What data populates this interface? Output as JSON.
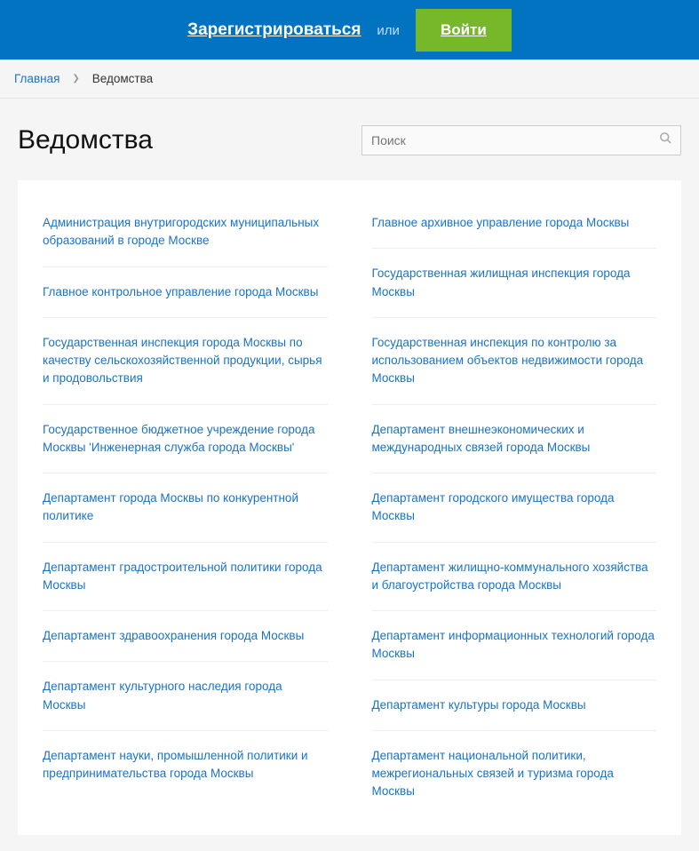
{
  "header": {
    "register": "Зарегистрироваться",
    "or": "или",
    "login": "Войти"
  },
  "breadcrumb": {
    "home": "Главная",
    "current": "Ведомства"
  },
  "page_title": "Ведомства",
  "search": {
    "placeholder": "Поиск"
  },
  "departments": {
    "left": [
      "Администрация внутригородских муниципальных образований в городе Москве",
      "Главное контрольное управление города Москвы",
      "Государственная инспекция города Москвы по качеству сельскохозяйственной продукции, сырья и продовольствия",
      "Государственное бюджетное учреждение города Москвы 'Инженерная служба города Москвы'",
      "Департамент города Москвы по конкурентной политике",
      "Департамент градостроительной политики города Москвы",
      "Департамент здравоохранения города Москвы",
      "Департамент культурного наследия города Москвы",
      "Департамент науки, промышленной политики и предпринимательства города Москвы"
    ],
    "right": [
      "Главное архивное управление города Москвы",
      "Государственная жилищная инспекция города Москвы",
      "Государственная инспекция по контролю за использованием объектов недвижимости города Москвы",
      "Департамент внешнеэкономических и международных связей города Москвы",
      "Департамент городского имущества города Москвы",
      "Департамент жилищно-коммунального хозяйства и благоустройства города Москвы",
      "Департамент информационных технологий города Москвы",
      "Департамент культуры города Москвы",
      "Департамент национальной политики, межрегиональных связей и туризма города Москвы"
    ]
  }
}
